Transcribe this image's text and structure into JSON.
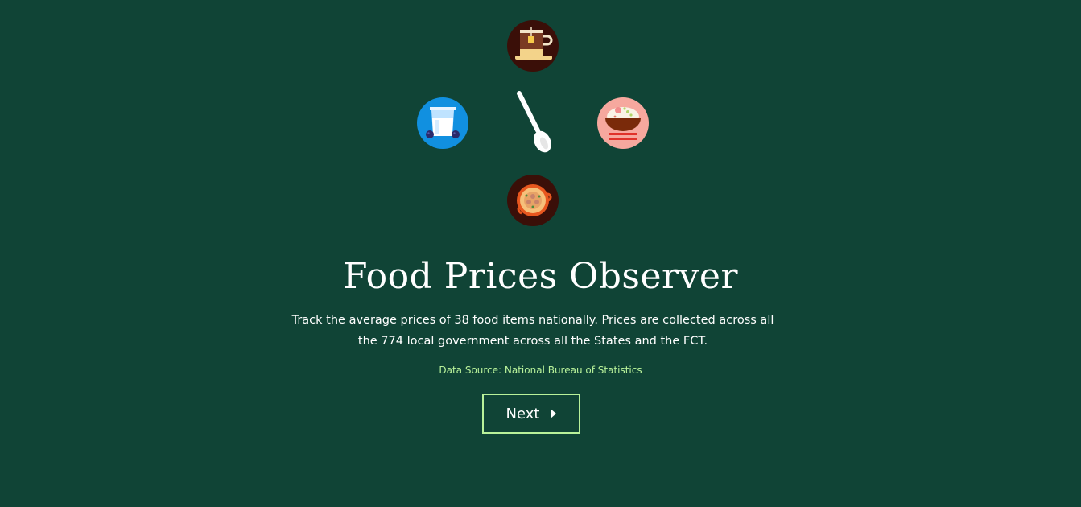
{
  "hero": {
    "title": "Food Prices Observer",
    "description": "Track the average prices of 38 food items nationally. Prices are collected across all the 774 local government across all the States and the FCT.",
    "source": "Data Source: National Bureau of Statistics"
  },
  "actions": {
    "next_label": "Next"
  },
  "icons": [
    "tea-cup-icon",
    "milk-glass-icon",
    "spoon-icon",
    "rice-bowl-icon",
    "soup-pan-icon"
  ],
  "colors": {
    "background": "#104436",
    "accent": "#b9f29a",
    "text": "#ffffff"
  }
}
